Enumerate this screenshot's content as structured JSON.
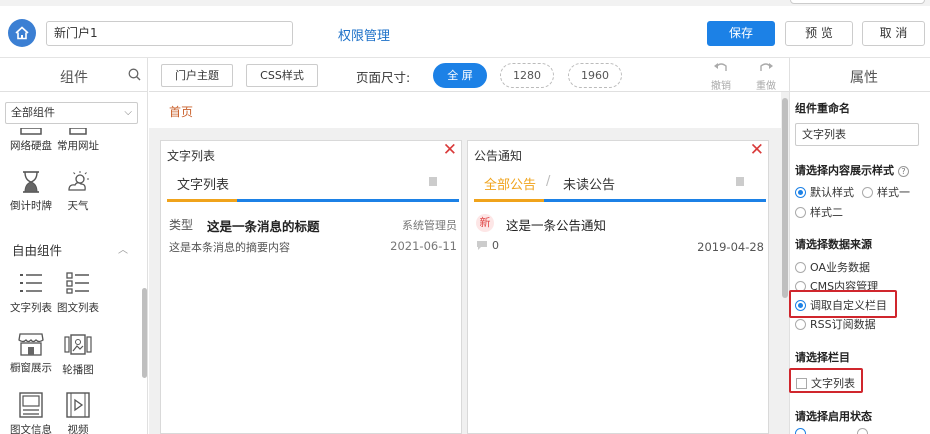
{
  "topbar": {
    "portal_name": "新门户1",
    "permission_link": "权限管理",
    "save_label": "保存",
    "preview_label": "预 览",
    "cancel_label": "取 消"
  },
  "left": {
    "title": "组件",
    "filter_value": "全部组件",
    "items_top": [
      {
        "label": "网络硬盘",
        "icon": "network-drive-icon"
      },
      {
        "label": "常用网址",
        "icon": "bookmark-icon"
      },
      {
        "label": "倒计时牌",
        "icon": "hourglass-icon"
      },
      {
        "label": "天气",
        "icon": "weather-icon"
      }
    ],
    "section_free": "自由组件",
    "items_free": [
      {
        "label": "文字列表",
        "icon": "text-list-icon"
      },
      {
        "label": "图文列表",
        "icon": "image-text-list-icon"
      },
      {
        "label": "橱窗展示",
        "icon": "showcase-icon"
      },
      {
        "label": "轮播图",
        "icon": "carousel-icon"
      },
      {
        "label": "图文信息",
        "icon": "image-info-icon"
      },
      {
        "label": "视频",
        "icon": "video-icon"
      }
    ]
  },
  "toolbar": {
    "theme_label": "门户主题",
    "css_label": "CSS样式",
    "size_label": "页面尺寸:",
    "sizes": [
      "全 屏",
      "1280",
      "1960"
    ],
    "undo_label": "撤销",
    "redo_label": "重做"
  },
  "canvas": {
    "breadcrumb": "首页",
    "panels": [
      {
        "title": "文字列表",
        "tabs": [
          "文字列表"
        ],
        "item": {
          "type": "类型",
          "title": "这是一条消息的标题",
          "author": "系统管理员",
          "summary": "这是本条消息的摘要内容",
          "date": "2021-06-11"
        }
      },
      {
        "title": "公告通知",
        "tabs": [
          "全部公告",
          "未读公告"
        ],
        "item": {
          "badge": "新",
          "title": "这是一条公告通知",
          "comments": "0",
          "date": "2019-04-28"
        }
      }
    ]
  },
  "right": {
    "title": "属性",
    "rename_heading": "组件重命名",
    "rename_value": "文字列表",
    "style_heading": "请选择内容展示样式",
    "style_options": [
      "默认样式",
      "样式一",
      "样式二"
    ],
    "style_selected": "默认样式",
    "source_heading": "请选择数据来源",
    "source_options": [
      "OA业务数据",
      "CMS内容管理",
      "调取自定义栏目",
      "RSS订阅数据"
    ],
    "source_selected": "调取自定义栏目",
    "column_heading": "请选择栏目",
    "column_option": "文字列表",
    "status_heading": "请选择启用状态",
    "accent": "#1c81e6",
    "highlight": "#d0262d"
  }
}
